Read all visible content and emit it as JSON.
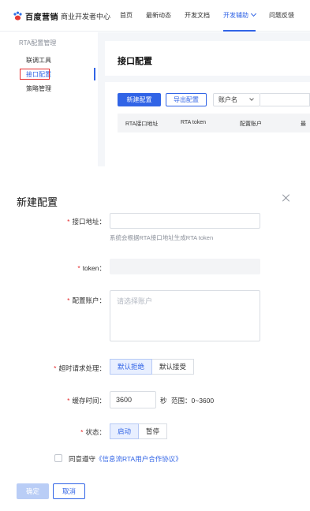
{
  "header": {
    "brand": "百度营销",
    "subtitle": "商业开发者中心",
    "nav": [
      "首页",
      "最新动态",
      "开发文档",
      "开发辅助",
      "问题反馈"
    ]
  },
  "sidebar": {
    "group": "RTA配置管理",
    "items": [
      "联调工具",
      "接口配置",
      "策略管理"
    ]
  },
  "page": {
    "title": "接口配置",
    "new_button": "新建配置",
    "export_button": "导出配置",
    "filter_select": "账户名",
    "columns": [
      "RTA接口地址",
      "RTA token",
      "配置账户",
      "最"
    ]
  },
  "modal": {
    "title": "新建配置",
    "fields": {
      "interface_label": "接口地址",
      "interface_hint": "系统会根据RTA接口地址生成RTA token",
      "token_label": "token",
      "account_label": "配置账户",
      "account_placeholder": "请选择账户",
      "timeout_label": "超时请求处理",
      "timeout_options": [
        "默认拒绝",
        "默认接受"
      ],
      "cache_label": "缓存时间",
      "cache_value": "3600",
      "cache_unit": "秒",
      "cache_range": "范围：0~3600",
      "status_label": "状态",
      "status_options": [
        "启动",
        "暂停"
      ]
    },
    "agree_prefix": "同意遵守",
    "agree_link": "《信息流RTA用户合作协议》",
    "confirm": "确定",
    "cancel": "取消"
  },
  "colors": {
    "accent": "#3164e6",
    "required": "#e5292b",
    "highlight": "#e5292b"
  }
}
